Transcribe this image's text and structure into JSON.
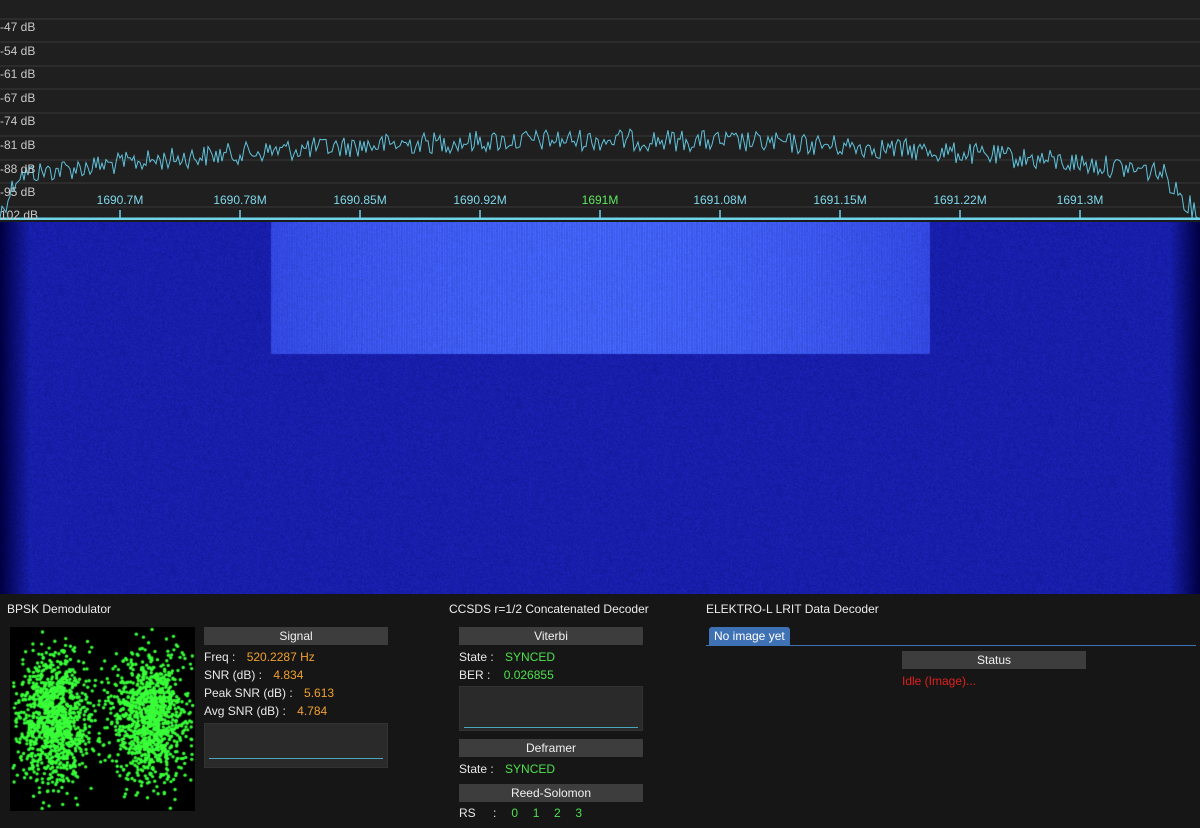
{
  "fft": {
    "db_labels": [
      "-47 dB",
      "-54 dB",
      "-61 dB",
      "-67 dB",
      "-74 dB",
      "-81 dB",
      "-88 dB",
      "-95 dB",
      "-102 dB"
    ],
    "freq_labels": [
      "1690.7M",
      "1690.78M",
      "1690.85M",
      "1690.92M",
      "1691M",
      "1691.08M",
      "1691.15M",
      "1691.22M",
      "1691.3M"
    ],
    "center_freq": "1691M",
    "trace_color": "#5fc3dc",
    "tuning_line_color": "#6fd4ea"
  },
  "waterfall": {
    "base_color": "#1a22b8",
    "signal_color": "#3a4cff"
  },
  "bpsk": {
    "title": "BPSK Demodulator",
    "signal_header": "Signal",
    "freq_label": "Freq :",
    "freq_value": "520.2287 Hz",
    "snr_label": "SNR (dB) :",
    "snr_value": "4.834",
    "peak_snr_label": "Peak SNR (dB) :",
    "peak_snr_value": "5.613",
    "avg_snr_label": "Avg SNR (dB) :",
    "avg_snr_value": "4.784",
    "constellation_color": "#39ff39"
  },
  "ccsds": {
    "title": "CCSDS r=1/2 Concatenated Decoder",
    "viterbi_header": "Viterbi",
    "viterbi_state_label": "State :",
    "viterbi_state_value": "SYNCED",
    "ber_label": "BER :",
    "ber_value": "0.026855",
    "deframer_header": "Deframer",
    "deframer_state_label": "State :",
    "deframer_state_value": "SYNCED",
    "rs_header": "Reed-Solomon",
    "rs_label": "RS",
    "rs_sep": ":",
    "rs_values": [
      "0",
      "1",
      "2",
      "3"
    ]
  },
  "elektro": {
    "title": "ELEKTRO-L LRIT Data Decoder",
    "tab_label": "No image yet",
    "status_header": "Status",
    "status_value": "Idle (Image)..."
  }
}
